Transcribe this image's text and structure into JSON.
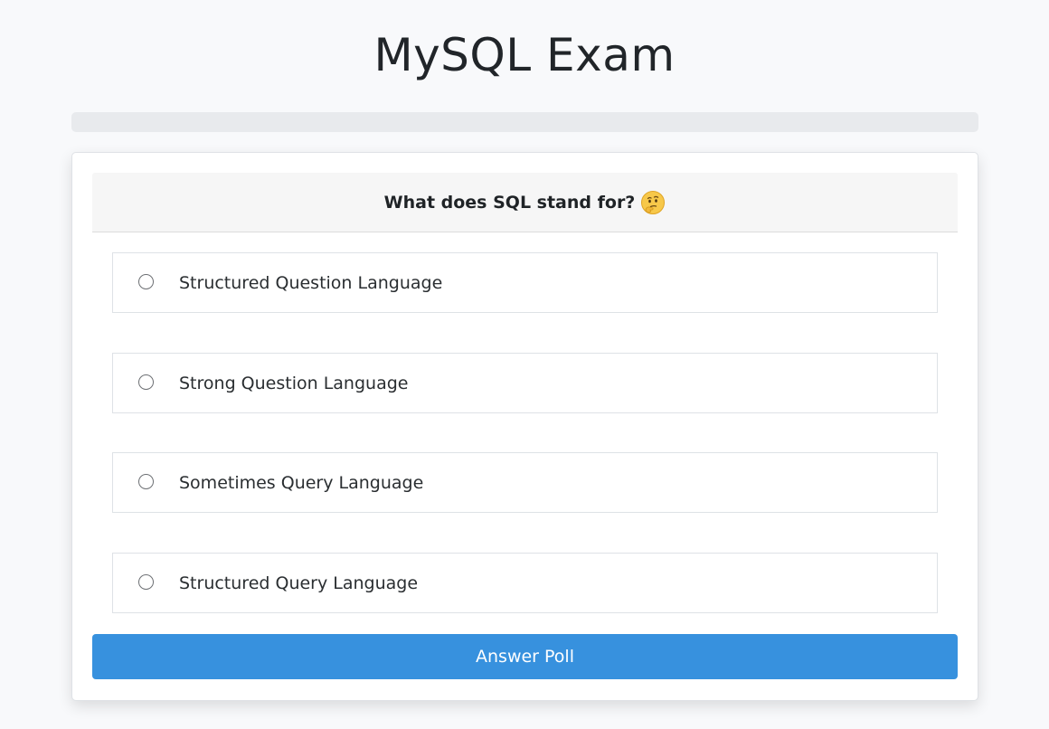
{
  "page": {
    "title": "MySQL Exam"
  },
  "progress": {
    "value_percent": 0,
    "track_color": "#e8eaed",
    "fill_color": "#3790dd"
  },
  "question": {
    "text": "What does SQL stand for?",
    "emoji_icon": "thinking-face-icon"
  },
  "options": [
    {
      "label": "Structured Question Language",
      "selected": false
    },
    {
      "label": "Strong Question Language",
      "selected": false
    },
    {
      "label": "Sometimes Query Language",
      "selected": false
    },
    {
      "label": "Structured Query Language",
      "selected": false
    }
  ],
  "submit": {
    "label": "Answer Poll",
    "color": "#3791de"
  }
}
